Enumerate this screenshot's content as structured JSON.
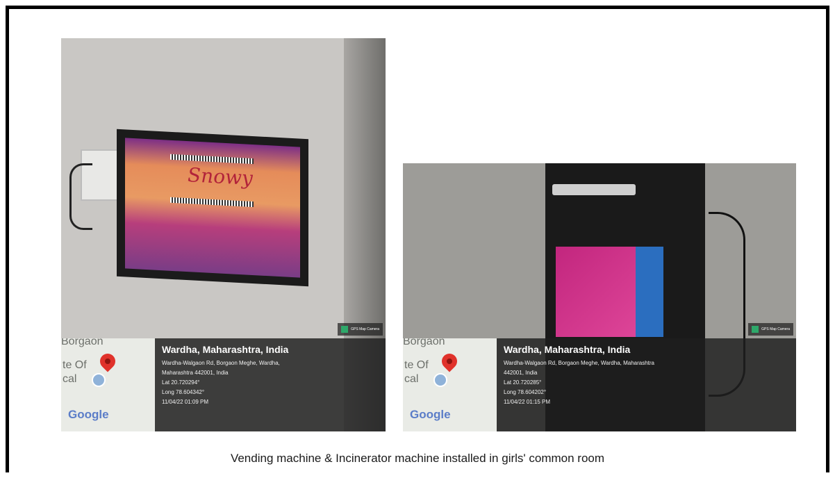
{
  "photos": [
    {
      "map_labels": {
        "top": "Borgaon",
        "left1": "te Of",
        "left2": "cal"
      },
      "map_logo": "Google",
      "location_title": "Wardha, Maharashtra, India",
      "address_line1": "Wardha-Walgaon Rd, Borgaon Meghe, Wardha,",
      "address_line2": "Maharashtra 442001, India",
      "lat": "Lat 20.720294°",
      "long": "Long 78.604342°",
      "datetime": "11/04/22 01:09 PM",
      "badge": "GPS Map Camera",
      "screen_brand": "Snowy"
    },
    {
      "map_labels": {
        "top": "Borgaon",
        "left1": "te Of",
        "left2": "cal"
      },
      "map_logo": "Google",
      "location_title": "Wardha, Maharashtra, India",
      "address_line1": "Wardha-Walgaon Rd, Borgaon Meghe, Wardha, Maharashtra",
      "address_line2": "442001, India",
      "lat": "Lat 20.720285°",
      "long": "Long 78.604202°",
      "datetime": "11/04/22 01:15 PM",
      "badge": "GPS Map Camera"
    }
  ],
  "caption": "Vending machine & Incinerator machine installed in girls' common room"
}
